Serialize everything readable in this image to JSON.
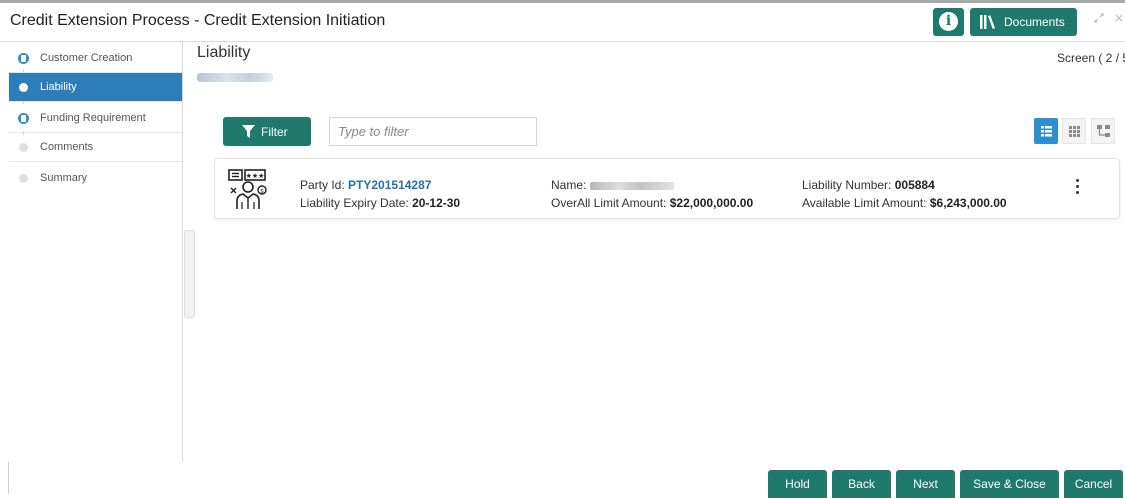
{
  "header": {
    "title": "Credit Extension Process - Credit Extension Initiation",
    "info_icon_glyph": "i",
    "documents_label": "Documents"
  },
  "steps": [
    {
      "label": "Customer Creation",
      "status": "done"
    },
    {
      "label": "Liability",
      "status": "current"
    },
    {
      "label": "Funding Requirement",
      "status": "done"
    },
    {
      "label": "Comments",
      "status": "pending"
    },
    {
      "label": "Summary",
      "status": "pending"
    }
  ],
  "main": {
    "title": "Liability",
    "screen_indicator": "Screen ( 2 / 5",
    "filter_label": "Filter",
    "filter_placeholder": "Type to filter"
  },
  "card": {
    "party_id_label": "Party Id:",
    "party_id": "PTY201514287",
    "expiry_label": "Liability Expiry Date:",
    "expiry": "20-12-30",
    "name_label": "Name:",
    "overall_label": "OverAll Limit Amount:",
    "overall": "$22,000,000.00",
    "liability_number_label": "Liability Number:",
    "liability_number": "005884",
    "available_label": "Available Limit Amount:",
    "available": "$6,243,000.00"
  },
  "footer": {
    "hold": "Hold",
    "back": "Back",
    "next": "Next",
    "save_close": "Save & Close",
    "cancel": "Cancel"
  },
  "colors": {
    "primary": "#1f7a6c",
    "active_step": "#2d7eb8",
    "link": "#2471a8"
  },
  "icons": [
    "info-icon",
    "library-icon",
    "minimize-icon",
    "close-icon",
    "filter-icon",
    "list-view-icon",
    "grid-view-icon",
    "tree-view-icon",
    "customer-avatar-icon",
    "kebab-menu-icon"
  ]
}
